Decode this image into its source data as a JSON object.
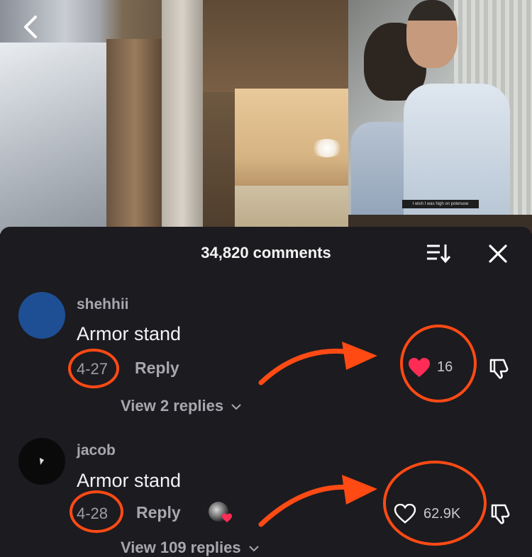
{
  "video": {
    "caption": "I wish I was high on potenuse",
    "back_icon": "chevron-left-icon"
  },
  "comments_panel": {
    "title": "34,820 comments",
    "sort_icon": "sort-icon",
    "close_icon": "close-icon",
    "comments": [
      {
        "username": "shehhii",
        "text": "Armor stand",
        "date": "4-27",
        "reply_label": "Reply",
        "likes": "16",
        "liked": true,
        "view_replies": "View 2 replies"
      },
      {
        "username": "jacob",
        "text": "Armor stand",
        "date": "4-28",
        "reply_label": "Reply",
        "likes": "62.9K",
        "liked": false,
        "view_replies": "View 109 replies"
      }
    ]
  },
  "colors": {
    "sheet_bg": "#1c1b20",
    "like_red": "#fe2c55",
    "annotation_orange": "#ff4a14",
    "avatar_blue": "#1e4f94"
  }
}
